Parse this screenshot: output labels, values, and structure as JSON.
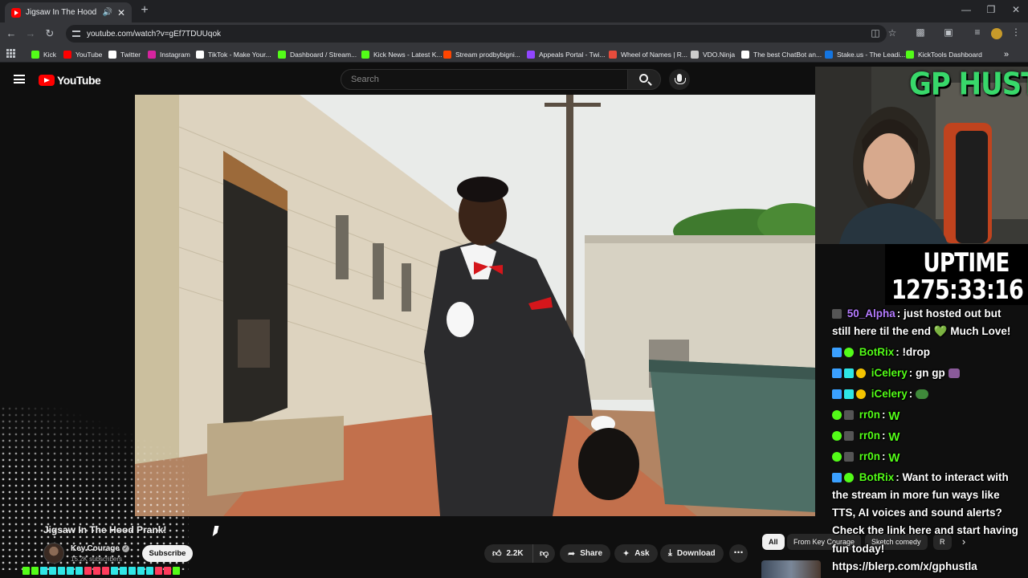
{
  "browser": {
    "tab_title": "Jigsaw In The Hood Prank!",
    "url": "youtube.com/watch?v=gEf7TDUUqok",
    "bookmarks": [
      {
        "label": "Kick",
        "color": "#53fc18"
      },
      {
        "label": "YouTube",
        "color": "#ff0000"
      },
      {
        "label": "Twitter",
        "color": "#ffffff"
      },
      {
        "label": "Instagram",
        "color": "#d6249f"
      },
      {
        "label": "TikTok - Make Your...",
        "color": "#ffffff"
      },
      {
        "label": "Dashboard / Stream...",
        "color": "#53fc18"
      },
      {
        "label": "Kick News - Latest K...",
        "color": "#53fc18"
      },
      {
        "label": "Stream prodbybigni...",
        "color": "#ff4500"
      },
      {
        "label": "Appeals Portal - Twi...",
        "color": "#9146ff"
      },
      {
        "label": "Wheel of Names | R...",
        "color": "#e74c3c"
      },
      {
        "label": "VDO.Ninja",
        "color": "#cccccc"
      },
      {
        "label": "The best ChatBot an...",
        "color": "#ffffff"
      },
      {
        "label": "Stake.us - The Leadi...",
        "color": "#1475e1"
      },
      {
        "label": "KickTools Dashboard",
        "color": "#53fc18"
      }
    ]
  },
  "youtube": {
    "logo_text": "YouTube",
    "search_placeholder": "Search",
    "video_title": "Jigsaw In The Hood Prank!",
    "channel_name": "Key.Courage",
    "subscribers": "15.2K subscribers",
    "subscribe_label": "Subscribe",
    "likes": "2.2K",
    "share_label": "Share",
    "ask_label": "Ask",
    "download_label": "Download",
    "chips": [
      "All",
      "From Key Courage",
      "Sketch comedy",
      "R"
    ]
  },
  "overlay": {
    "cam_label": "GP HUSTLA",
    "uptime_label": "UPTIME",
    "uptime_value": "1275:33:16",
    "chat": [
      {
        "user": "50_Alpha",
        "user_color": "#b57bff",
        "text": ": just hosted out but"
      },
      {
        "user": "",
        "user_color": "#ffffff",
        "text": "still here til the end 💚 Much Love!"
      },
      {
        "user": "BotRix",
        "user_color": "#53fc18",
        "text": ": !drop"
      },
      {
        "user": "iCelery",
        "user_color": "#53fc18",
        "text": ": gn gp"
      },
      {
        "user": "iCelery",
        "user_color": "#53fc18",
        "text": ":"
      },
      {
        "user": "rr0n",
        "user_color": "#53fc18",
        "text": ":"
      },
      {
        "user": "rr0n",
        "user_color": "#53fc18",
        "text": ":"
      },
      {
        "user": "rr0n",
        "user_color": "#53fc18",
        "text": ":"
      },
      {
        "user": "BotRix",
        "user_color": "#53fc18",
        "text": ": Want to interact with"
      },
      {
        "user": "",
        "user_color": "#ffffff",
        "text": "the stream in more fun ways like"
      },
      {
        "user": "",
        "user_color": "#ffffff",
        "text": "TTS, AI voices and sound alerts?"
      },
      {
        "user": "",
        "user_color": "#ffffff",
        "text": "Check the link here and start having"
      },
      {
        "user": "",
        "user_color": "#ffffff",
        "text": "fun today!"
      },
      {
        "user": "",
        "user_color": "#ffffff",
        "text": "https://blerp.com/x/gphustla"
      }
    ]
  },
  "colors": {
    "accent_green": "#53fc18",
    "cam_label_green": "#38d86a",
    "youtube_red": "#ff0000"
  }
}
